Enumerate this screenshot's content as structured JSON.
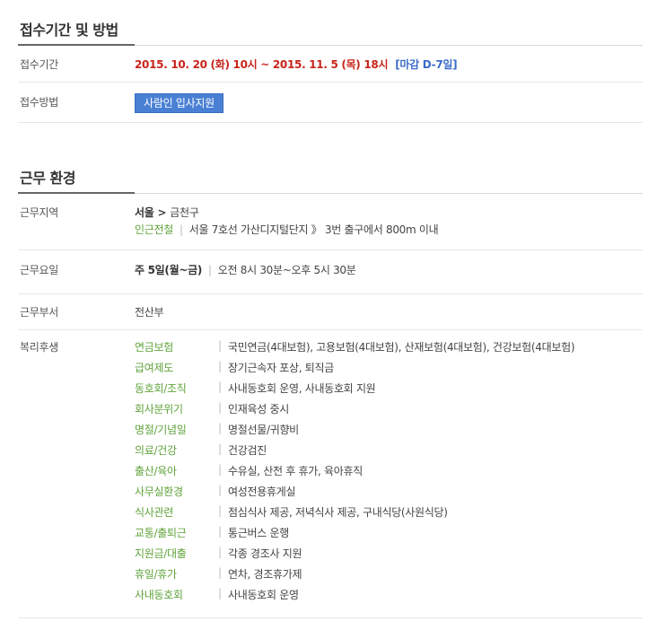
{
  "reception": {
    "title": "접수기간 및 방법",
    "period_label": "접수기간",
    "period_value": "2015. 10. 20 (화) 10시 ~ 2015. 11. 5 (목) 18시",
    "deadline": "[마감 D-7일]",
    "method_label": "접수방법",
    "apply_button": "사람인 입사지원"
  },
  "work": {
    "title": "근무 환경",
    "location_label": "근무지역",
    "location_city": "서울",
    "location_chevron": ">",
    "location_district": "금천구",
    "station_label": "인근전철",
    "station_sep": "|",
    "station_value": "서울 7호선 가산디지털단지 》 3번 출구에서 800m 이내",
    "days_label": "근무요일",
    "days_value": "주 5일(월~금)",
    "days_sep": "|",
    "hours_value": "오전 8시 30분~오후 5시 30분",
    "dept_label": "근무부서",
    "dept_value": "전산부",
    "welfare_label": "복리후생",
    "welfare_sep": "|",
    "welfare": [
      {
        "category": "연금보험",
        "value": "국민연금(4대보험), 고용보험(4대보험), 산재보험(4대보험), 건강보험(4대보험)"
      },
      {
        "category": "급여제도",
        "value": "장기근속자 포상, 퇴직금"
      },
      {
        "category": "동호회/조직",
        "value": "사내동호회 운영, 사내동호회 지원"
      },
      {
        "category": "회사분위기",
        "value": "인재육성 중시"
      },
      {
        "category": "명절/기념일",
        "value": "명절선물/귀향비"
      },
      {
        "category": "의료/건강",
        "value": "건강검진"
      },
      {
        "category": "출산/육아",
        "value": "수유실, 산전 후 휴가, 육아휴직"
      },
      {
        "category": "사무실환경",
        "value": "여성전용휴게실"
      },
      {
        "category": "식사관련",
        "value": "점심식사 제공, 저녁식사 제공, 구내식당(사원식당)"
      },
      {
        "category": "교통/출퇴근",
        "value": "통근버스 운행"
      },
      {
        "category": "지원금/대출",
        "value": "각종 경조사 지원"
      },
      {
        "category": "휴일/휴가",
        "value": "연차, 경조휴가제"
      },
      {
        "category": "사내동호회",
        "value": "사내동호회 운영"
      }
    ]
  }
}
